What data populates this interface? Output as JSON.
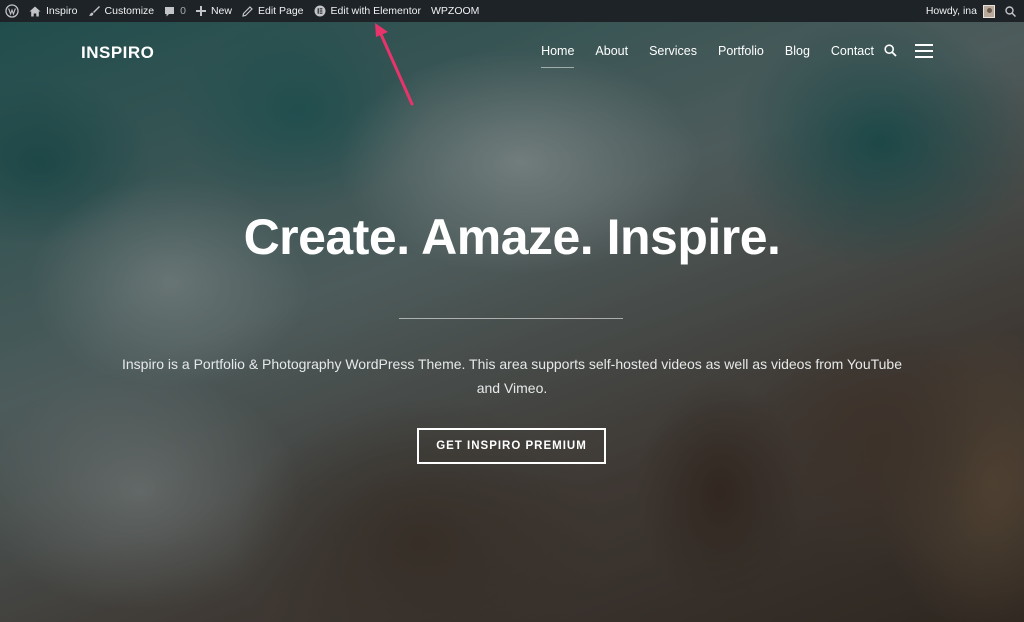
{
  "admin_bar": {
    "site_name": "Inspiro",
    "customize": "Customize",
    "comments_count": "0",
    "new": "New",
    "edit_page": "Edit Page",
    "edit_elementor": "Edit with Elementor",
    "wpzoom": "WPZOOM",
    "howdy": "Howdy, ina"
  },
  "header": {
    "logo": "INSPIRO",
    "nav": [
      {
        "label": "Home",
        "active": true
      },
      {
        "label": "About"
      },
      {
        "label": "Services"
      },
      {
        "label": "Portfolio"
      },
      {
        "label": "Blog"
      },
      {
        "label": "Contact"
      }
    ]
  },
  "hero": {
    "title": "Create. Amaze. Inspire.",
    "description": "Inspiro is a Portfolio & Photography WordPress Theme. This area supports self-hosted videos as well as videos from YouTube and Vimeo.",
    "cta": "GET INSPIRO PREMIUM"
  },
  "colors": {
    "admin_bar_bg": "#1d2327",
    "annotation_arrow": "#e8336b"
  },
  "icons": [
    "wordpress-icon",
    "home-icon",
    "brush-icon",
    "comment-icon",
    "plus-icon",
    "pencil-icon",
    "elementor-icon",
    "search-icon",
    "hamburger-icon"
  ]
}
